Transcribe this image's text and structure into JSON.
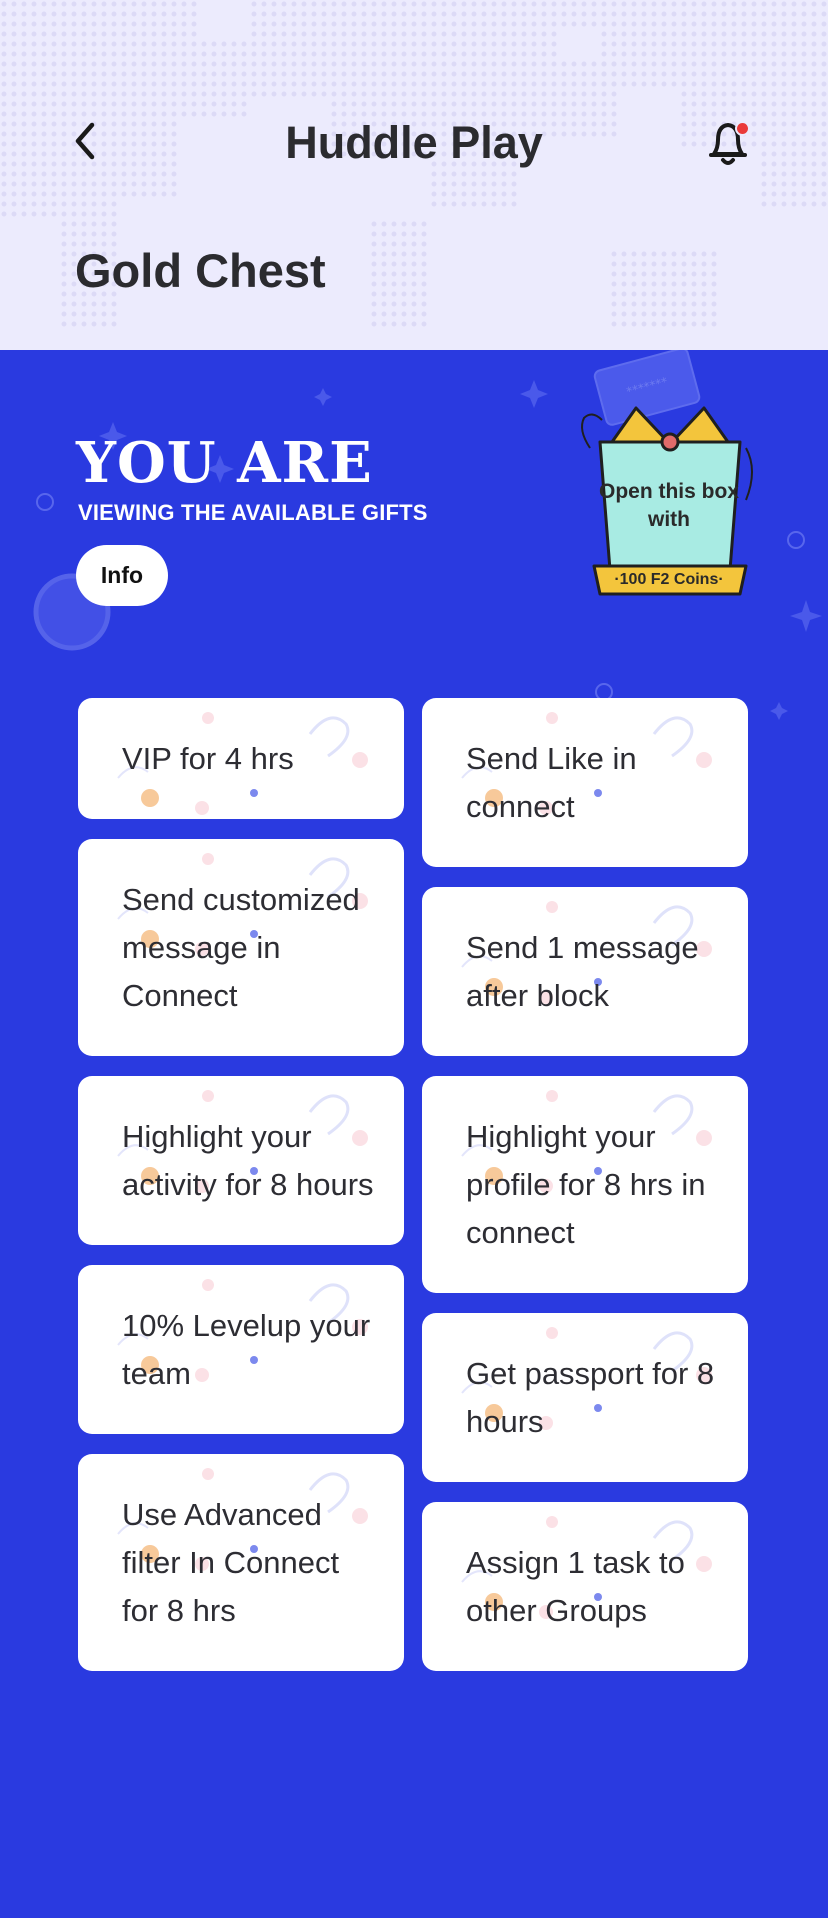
{
  "header": {
    "title": "Huddle Play",
    "subtitle": "Gold Chest"
  },
  "hero": {
    "heading": "YOU ARE",
    "subheading": "VIEWING THE AVAILABLE GIFTS",
    "info_label": "Info",
    "chest_text": "Open this box with",
    "coins_label": "·100 F2 Coins·",
    "card_mask": "*******"
  },
  "gifts_left": [
    {
      "label": "VIP for 4 hrs"
    },
    {
      "label": "Send customized message in Connect"
    },
    {
      "label": "Highlight your activity for 8 hours"
    },
    {
      "label": "10% Levelup your team"
    },
    {
      "label": "Use Advanced filter In Connect for 8 hrs"
    }
  ],
  "gifts_right": [
    {
      "label": "Send Like in connect"
    },
    {
      "label": "Send 1 message after block"
    },
    {
      "label": "Highlight your profile for 8 hrs in connect"
    },
    {
      "label": "Get passport for 8 hours"
    },
    {
      "label": "Assign 1 task to other Groups"
    }
  ],
  "colors": {
    "header_bg": "#ecebfd",
    "accent_blue": "#2a3ae0",
    "notification_dot": "#ea3a3a",
    "chest_lid": "#f3c53c",
    "chest_box": "#a8ebe3"
  },
  "icons": [
    "back-arrow-icon",
    "bell-icon",
    "gift-chest-icon"
  ]
}
